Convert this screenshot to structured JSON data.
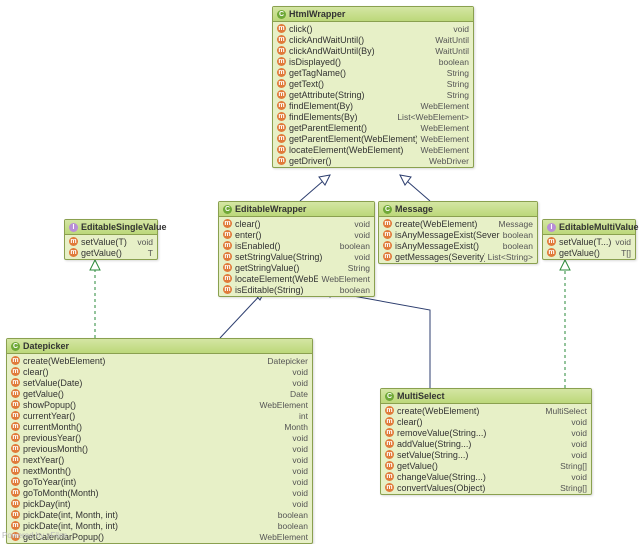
{
  "footer": "Powered by yFiles",
  "classes": {
    "HtmlWrapper": {
      "title": "HtmlWrapper",
      "kind": "C",
      "rows": [
        [
          "click()",
          "void"
        ],
        [
          "clickAndWaitUntil()",
          "WaitUntil"
        ],
        [
          "clickAndWaitUntil(By)",
          "WaitUntil"
        ],
        [
          "isDisplayed()",
          "boolean"
        ],
        [
          "getTagName()",
          "String"
        ],
        [
          "getText()",
          "String"
        ],
        [
          "getAttribute(String)",
          "String"
        ],
        [
          "findElement(By)",
          "WebElement"
        ],
        [
          "findElements(By)",
          "List<WebElement>"
        ],
        [
          "getParentElement()",
          "WebElement"
        ],
        [
          "getParentElement(WebElement)",
          "WebElement"
        ],
        [
          "locateElement(WebElement)",
          "WebElement"
        ],
        [
          "getDriver()",
          "WebDriver"
        ]
      ]
    },
    "EditableWrapper": {
      "title": "EditableWrapper",
      "kind": "C",
      "rows": [
        [
          "clear()",
          "void"
        ],
        [
          "enter()",
          "void"
        ],
        [
          "isEnabled()",
          "boolean"
        ],
        [
          "setStringValue(String)",
          "void"
        ],
        [
          "getStringValue()",
          "String"
        ],
        [
          "locateElement(WebElement)",
          "WebElement"
        ],
        [
          "isEditable(String)",
          "boolean"
        ]
      ]
    },
    "Message": {
      "title": "Message",
      "kind": "C",
      "rows": [
        [
          "create(WebElement)",
          "Message"
        ],
        [
          "isAnyMessageExist(Severity)",
          "boolean"
        ],
        [
          "isAnyMessageExist()",
          "boolean"
        ],
        [
          "getMessages(Severity)",
          "List<String>"
        ]
      ]
    },
    "EditableSingleValue": {
      "title": "EditableSingleValue",
      "kind": "I",
      "rows": [
        [
          "setValue(T)",
          "void"
        ],
        [
          "getValue()",
          "T"
        ]
      ]
    },
    "EditableMultiValue": {
      "title": "EditableMultiValue",
      "kind": "I",
      "rows": [
        [
          "setValue(T...)",
          "void"
        ],
        [
          "getValue()",
          "T[]"
        ]
      ]
    },
    "Datepicker": {
      "title": "Datepicker",
      "kind": "C",
      "rows": [
        [
          "create(WebElement)",
          "Datepicker"
        ],
        [
          "clear()",
          "void"
        ],
        [
          "setValue(Date)",
          "void"
        ],
        [
          "getValue()",
          "Date"
        ],
        [
          "showPopup()",
          "WebElement"
        ],
        [
          "currentYear()",
          "int"
        ],
        [
          "currentMonth()",
          "Month"
        ],
        [
          "previousYear()",
          "void"
        ],
        [
          "previousMonth()",
          "void"
        ],
        [
          "nextYear()",
          "void"
        ],
        [
          "nextMonth()",
          "void"
        ],
        [
          "goToYear(int)",
          "void"
        ],
        [
          "goToMonth(Month)",
          "void"
        ],
        [
          "pickDay(int)",
          "void"
        ],
        [
          "pickDate(int, Month, int)",
          "boolean"
        ],
        [
          "pickDate(int, Month, int)",
          "boolean"
        ],
        [
          "getCalendarPopup()",
          "WebElement"
        ]
      ]
    },
    "MultiSelect": {
      "title": "MultiSelect",
      "kind": "C",
      "rows": [
        [
          "create(WebElement)",
          "MultiSelect"
        ],
        [
          "clear()",
          "void"
        ],
        [
          "removeValue(String...)",
          "void"
        ],
        [
          "addValue(String...)",
          "void"
        ],
        [
          "setValue(String...)",
          "void"
        ],
        [
          "getValue()",
          "String[]"
        ],
        [
          "changeValue(String...)",
          "void"
        ],
        [
          "convertValues(Object)",
          "String[]"
        ]
      ]
    }
  }
}
